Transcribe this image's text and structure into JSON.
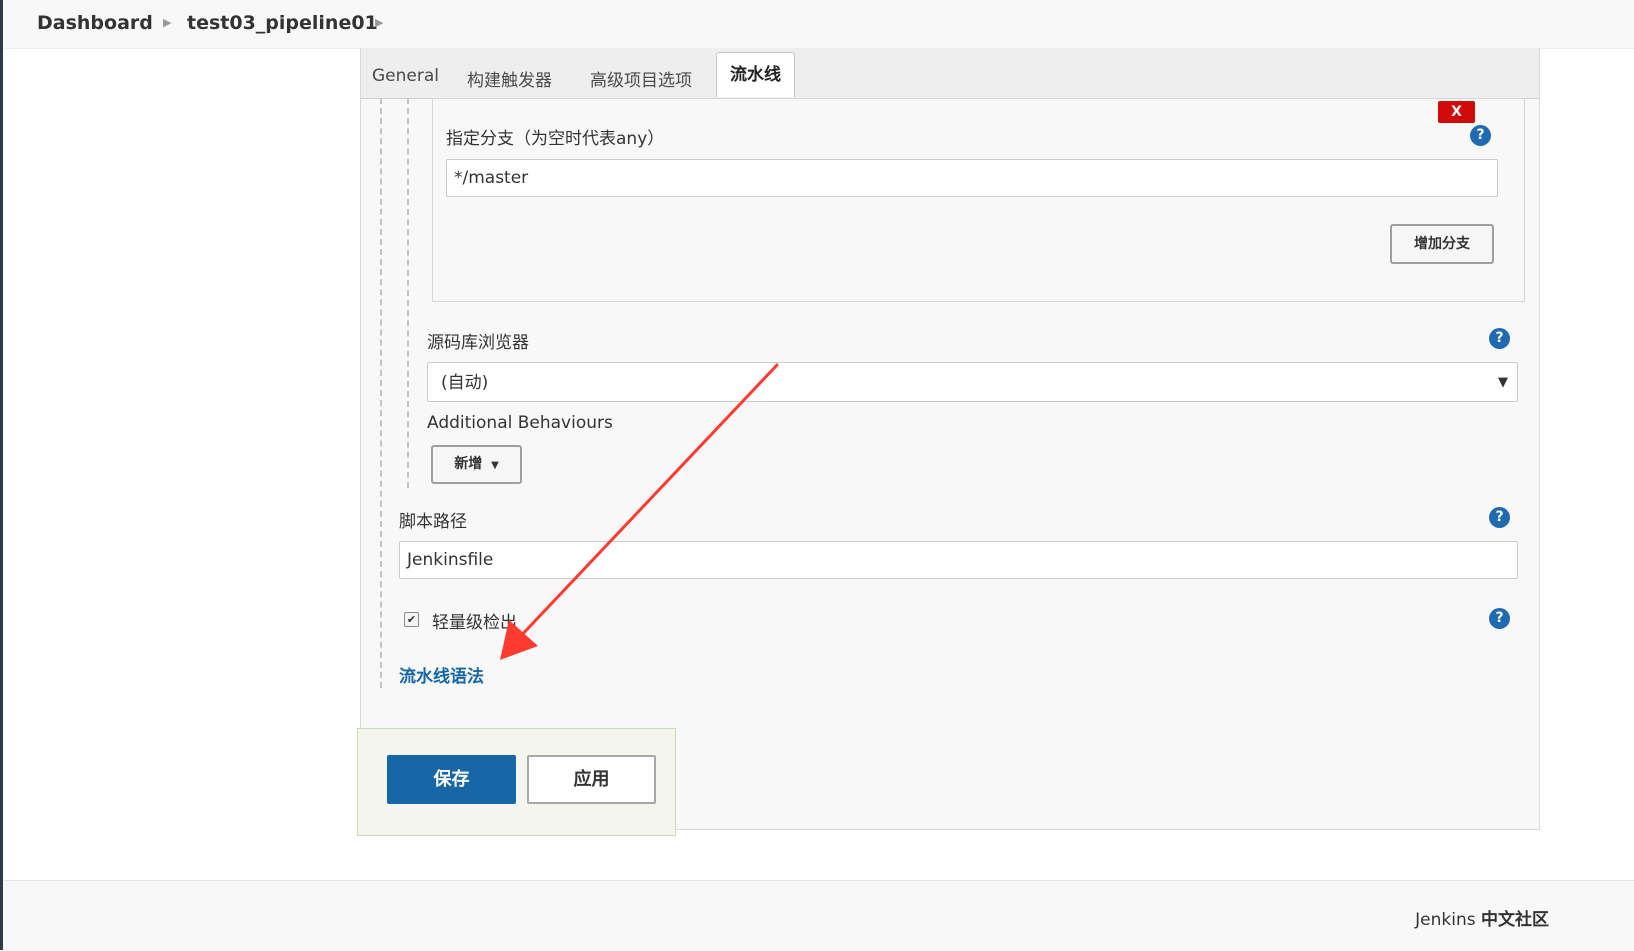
{
  "breadcrumb": {
    "items": [
      "Dashboard",
      "test03_pipeline01"
    ]
  },
  "tabs": [
    {
      "label": "General",
      "active": false
    },
    {
      "label": "构建触发器",
      "active": false
    },
    {
      "label": "高级项目选项",
      "active": false
    },
    {
      "label": "流水线",
      "active": true
    }
  ],
  "branch_spec": {
    "delete_label": "X",
    "label": "指定分支（为空时代表any）",
    "value": "*/master",
    "add_branch_label": "增加分支"
  },
  "repo_browser": {
    "label": "源码库浏览器",
    "selected": "(自动)"
  },
  "additional_behaviours": {
    "label": "Additional Behaviours",
    "add_label": "新增"
  },
  "script_path": {
    "label": "脚本路径",
    "value": "Jenkinsfile"
  },
  "lightweight_checkout": {
    "label": "轻量级检出",
    "checked": true
  },
  "pipeline_syntax_link": "流水线语法",
  "help_glyph": "?",
  "actions": {
    "save": "保存",
    "apply": "应用"
  },
  "footer": {
    "brand": "Jenkins",
    "community": "中文社区"
  },
  "colors": {
    "primary": "#1766a6",
    "danger": "#d10a0a",
    "annotation": "#ff3b30"
  },
  "icons": {
    "breadcrumb_separator": "chevron-right-icon",
    "help": "question-circle-icon",
    "dropdown": "caret-down-icon",
    "delete": "close-x-icon",
    "annotation": "red-arrow-icon"
  }
}
